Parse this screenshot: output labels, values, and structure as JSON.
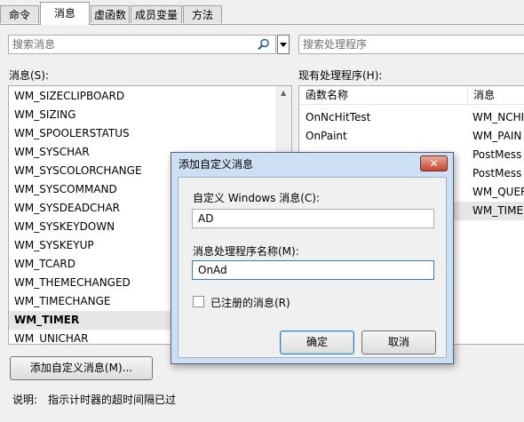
{
  "tabs": [
    "命令",
    "消息",
    "虚函数",
    "成员变量",
    "方法"
  ],
  "active_tab": "消息",
  "search_messages": {
    "placeholder": "搜索消息"
  },
  "search_handlers": {
    "placeholder": "搜索处理程序"
  },
  "messages_label": "消息(S):",
  "messages": [
    "WM_SIZECLIPBOARD",
    "WM_SIZING",
    "WM_SPOOLERSTATUS",
    "WM_SYSCHAR",
    "WM_SYSCOLORCHANGE",
    "WM_SYSCOMMAND",
    "WM_SYSDEADCHAR",
    "WM_SYSKEYDOWN",
    "WM_SYSKEYUP",
    "WM_TCARD",
    "WM_THEMECHANGED",
    "WM_TIMECHANGE",
    "WM_TIMER",
    "WM_UNICHAR"
  ],
  "selected_message": "WM_TIMER",
  "handlers_label": "现有处理程序(H):",
  "handlers_columns": [
    "函数名称",
    "消息"
  ],
  "handlers": [
    {
      "func": "OnNcHitTest",
      "msg": "WM_NCHI"
    },
    {
      "func": "OnPaint",
      "msg": "WM_PAIN"
    },
    {
      "func": "",
      "msg": "PostMess"
    },
    {
      "func": "",
      "msg": "PostMess"
    },
    {
      "func": "",
      "msg": "WM_QUER"
    },
    {
      "func": "",
      "msg": "WM_TIME"
    }
  ],
  "add_custom_button": "添加自定义消息(M)...",
  "description": {
    "label": "说明:",
    "text": "指示计时器的超时间隔已过"
  },
  "dialog": {
    "title": "添加自定义消息",
    "close_symbol": "✕",
    "custom_message_label": "自定义 Windows 消息(C):",
    "custom_message_value": "AD",
    "handler_name_label": "消息处理程序名称(M):",
    "handler_name_value": "OnAd",
    "registered_label": "已注册的消息(R)",
    "ok_label": "确定",
    "cancel_label": "取消"
  }
}
